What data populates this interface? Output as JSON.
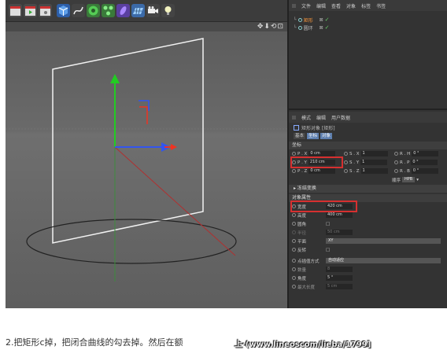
{
  "toolbar": {
    "icons": [
      "clapboard-icon",
      "clapboard-play-icon",
      "clapboard-gear-icon",
      "cube-icon",
      "pen-spline-icon",
      "subdivision-icon",
      "array-icon",
      "deformer-icon",
      "floor-icon",
      "camera-icon",
      "light-icon"
    ]
  },
  "viewport": {
    "nav_icons": "✥⬇⟲⊡"
  },
  "object_manager": {
    "menu": [
      "文件",
      "编辑",
      "查看",
      "对象",
      "标签",
      "书签"
    ],
    "objects": [
      {
        "name": "矩形",
        "flags": "⊠",
        "check": "✓",
        "selected": true
      },
      {
        "name": "圆环",
        "flags": "⊠",
        "check": "✓",
        "selected": false
      }
    ]
  },
  "attribute_manager": {
    "menu": [
      "模式",
      "编辑",
      "用户数据"
    ],
    "object_title": "矩形对象 [矩形]",
    "tabs": [
      "基本",
      "坐标",
      "对象"
    ],
    "coord_section": "坐标",
    "pos": {
      "x_label": "P . X",
      "x": "0 cm",
      "y_label": "P . Y",
      "y": "210 cm",
      "z_label": "P . Z",
      "z": "0 cm"
    },
    "scale": {
      "x_label": "S . X",
      "x": "1",
      "y_label": "S . Y",
      "y": "1",
      "z_label": "S . Z",
      "z": "1"
    },
    "rot": {
      "h_label": "R . H",
      "h": "0 °",
      "p_label": "R . P",
      "p": "0 °",
      "b_label": "R . B",
      "b": "0 °"
    },
    "order_label": "顺序",
    "order_value": "HPB",
    "freeze_label": "▸ 冻结变换",
    "props_section": "对象属性",
    "width_label": "宽度",
    "width": "420 cm",
    "height_label": "高度",
    "height": "400 cm",
    "rounding_label": "圆角",
    "rounding": "□",
    "radius_label": "半径",
    "radius": "50 cm",
    "plane_label": "平面",
    "plane": "XY",
    "reverse_label": "反转",
    "reverse": "□",
    "interp_label": "点插值方式",
    "interp": "自动适应",
    "count_label": "数量",
    "count": "8",
    "angle_label": "角度",
    "angle": "5 °",
    "maxlen_label": "最大长度",
    "maxlen": "5 cm"
  },
  "caption": "2.把矩形c掉，把闭合曲线的勾去掉。然后在额",
  "watermark": "上·(www.lineoscom/lieba/1799]"
}
